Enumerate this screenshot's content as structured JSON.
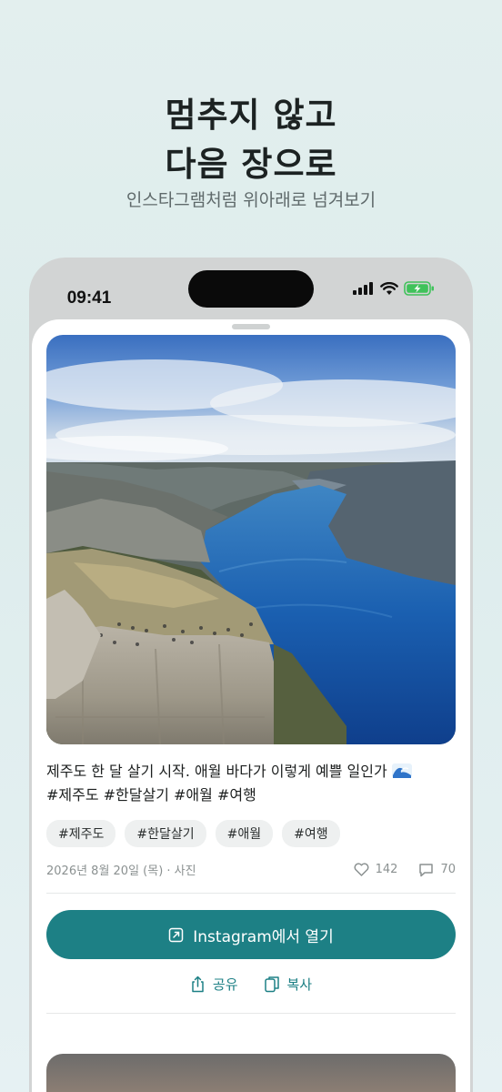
{
  "promo": {
    "headline_line1": "멈추지 않고",
    "headline_line2": "다음 장으로",
    "subhead": "인스타그램처럼 위아래로 넘겨보기"
  },
  "status_bar": {
    "time": "09:41",
    "icons": [
      "cellular-signal-icon",
      "wifi-icon",
      "battery-charging-icon"
    ]
  },
  "post": {
    "image": "fjord-cliff-photo",
    "caption_line1": "제주도 한 달 살기 시작. 애월 바다가 이렇게 예쁠 일인가",
    "caption_emoji": "wave-emoji",
    "caption_line2": "#제주도 #한달살기 #애월 #여행",
    "tags": [
      "#제주도",
      "#한달살기",
      "#애월",
      "#여행"
    ],
    "meta": "2026년 8월 20일 (목) · 사진",
    "likes": "142",
    "comments": "70",
    "open_button": "Instagram에서 열기",
    "share_label": "공유",
    "copy_label": "복사"
  },
  "colors": {
    "accent": "#1d8085",
    "background": "#e3efee",
    "battery": "#3fc25a"
  }
}
